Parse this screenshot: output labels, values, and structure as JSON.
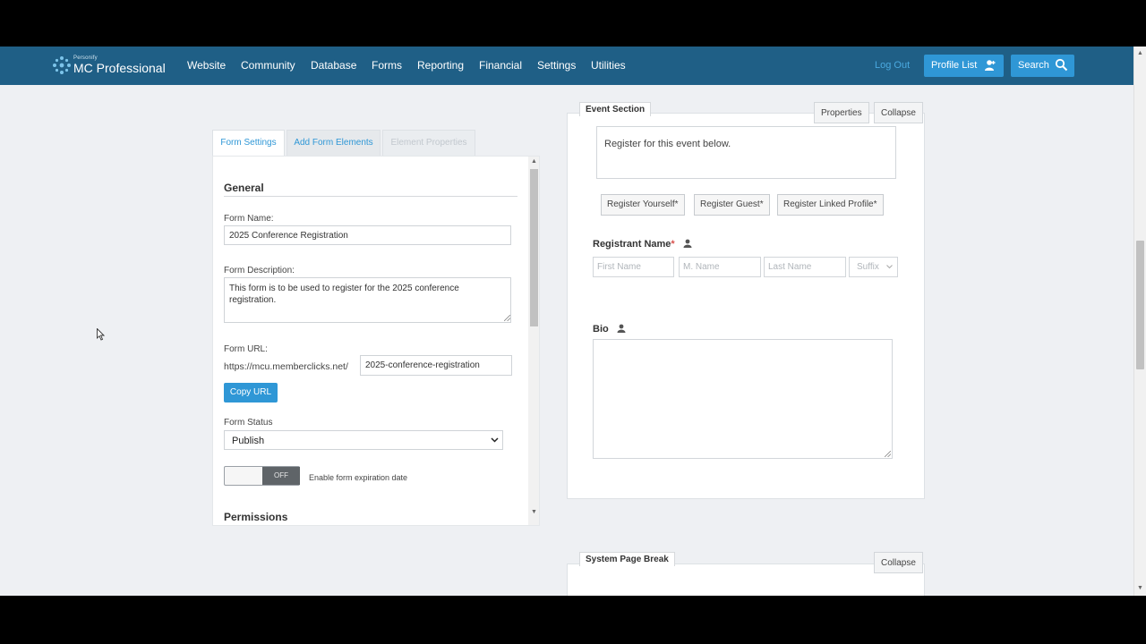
{
  "nav": {
    "logo_small": "Personify",
    "logo_main": "MC Professional",
    "items": [
      "Website",
      "Community",
      "Database",
      "Forms",
      "Reporting",
      "Financial",
      "Settings",
      "Utilities"
    ],
    "logout": "Log Out",
    "profile_list": "Profile List",
    "search": "Search"
  },
  "tabs": {
    "form_settings": "Form Settings",
    "add_form_elements": "Add Form Elements",
    "element_properties": "Element Properties"
  },
  "settings": {
    "general_heading": "General",
    "form_name_label": "Form Name:",
    "form_name_value": "2025 Conference Registration",
    "form_description_label": "Form Description:",
    "form_description_value": "This form is to be used to register for the 2025 conference registration.",
    "form_url_label": "Form URL:",
    "url_prefix": "https://mcu.memberclicks.net/",
    "url_slug": "2025-conference-registration",
    "copy_url": "Copy URL",
    "form_status_label": "Form Status",
    "form_status_value": "Publish",
    "toggle_state": "OFF",
    "expiration_label": "Enable form expiration date",
    "permissions_heading": "Permissions"
  },
  "event_section": {
    "tab_label": "Event Section",
    "properties": "Properties",
    "collapse": "Collapse",
    "intro_text": "Register for this event below.",
    "register_buttons": [
      "Register Yourself*",
      "Register Guest*",
      "Register Linked Profile*"
    ],
    "registrant_name_label": "Registrant Name",
    "required_mark": "*",
    "name_placeholders": {
      "first": "First Name",
      "middle": "M. Name",
      "last": "Last Name",
      "suffix": "Suffix"
    },
    "bio_label": "Bio"
  },
  "page_break": {
    "tab_label": "System Page Break",
    "collapse": "Collapse"
  },
  "colors": {
    "nav_bg": "#1f5f86",
    "accent": "#2f97d6",
    "required": "#d9534f"
  }
}
